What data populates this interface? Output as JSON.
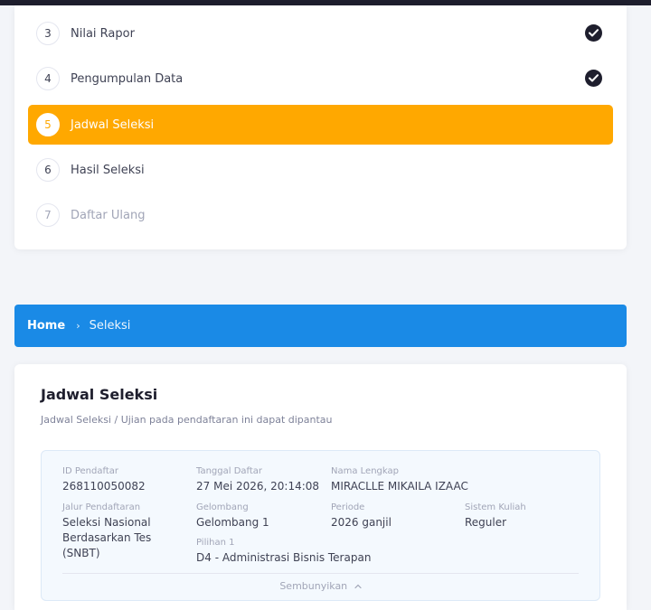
{
  "steps": [
    {
      "num": "3",
      "label": "Nilai Rapor",
      "state": "done"
    },
    {
      "num": "4",
      "label": "Pengumpulan Data",
      "state": "done"
    },
    {
      "num": "5",
      "label": "Jadwal Seleksi",
      "state": "active"
    },
    {
      "num": "6",
      "label": "Hasil Seleksi",
      "state": "pending"
    },
    {
      "num": "7",
      "label": "Daftar Ulang",
      "state": "disabled"
    }
  ],
  "breadcrumb": {
    "home": "Home",
    "separator": "›",
    "current": "Seleksi"
  },
  "main": {
    "title": "Jadwal Seleksi",
    "subtitle": "Jadwal Seleksi / Ujian pada pendaftaran ini dapat dipantau"
  },
  "info": {
    "id_label": "ID Pendaftar",
    "id_value": "268110050082",
    "tanggal_label": "Tanggal Daftar",
    "tanggal_value": "27 Mei 2026, 20:14:08",
    "nama_label": "Nama Lengkap",
    "nama_value": "MIRACLLE MIKAILA IZAAC",
    "jalur_label": "Jalur Pendaftaran",
    "jalur_value": "Seleksi Nasional Berdasarkan Tes (SNBT)",
    "gelombang_label": "Gelombang",
    "gelombang_value": "Gelombang 1",
    "periode_label": "Periode",
    "periode_value": "2026 ganjil",
    "sistem_label": "Sistem Kuliah",
    "sistem_value": "Reguler",
    "pilihan_label": "Pilihan 1",
    "pilihan_value": "D4 - Administrasi Bisnis Terapan",
    "toggle_label": "Sembunyikan",
    "toggle_icon": "chevron-up-icon"
  },
  "colors": {
    "active": "#ffa800",
    "breadcrumb": "#1a8ae6",
    "check": "#1e1e2d"
  }
}
